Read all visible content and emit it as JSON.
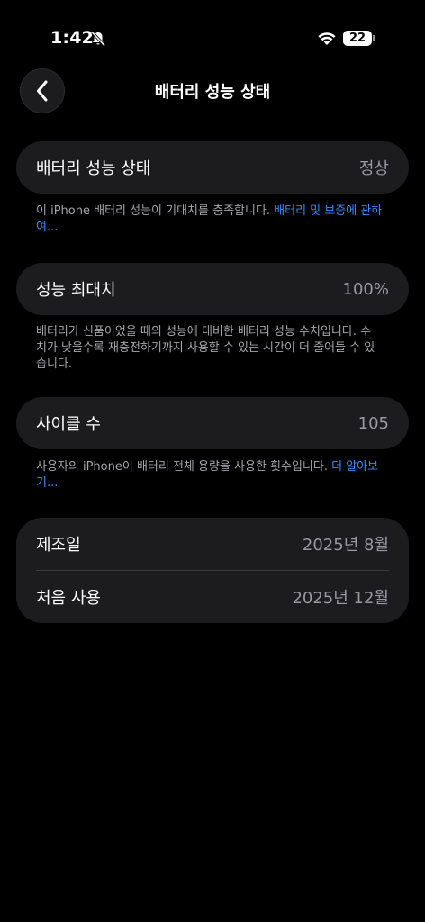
{
  "status_bar": {
    "time": "1:42",
    "battery_level": "22",
    "battery_fraction": 0.22
  },
  "nav": {
    "title": "배터리 성능 상태"
  },
  "sections": {
    "health": {
      "label": "배터리 성능 상태",
      "value": "정상",
      "footnote_text": "이 iPhone 배터리 성능이 기대치를 충족합니다. ",
      "footnote_link": "배터리 및 보증에 관하여..."
    },
    "max_capacity": {
      "label": "성능 최대치",
      "value": "100%",
      "footnote_text": "배터리가 신품이었을 때의 성능에 대비한 배터리 성능 수치입니다. 수치가 낮을수록 재충전하기까지 사용할 수 있는 시간이 더 줄어들 수 있습니다."
    },
    "cycle_count": {
      "label": "사이클 수",
      "value": "105",
      "footnote_text": "사용자의 iPhone이 배터리 전체 용량을 사용한 횟수입니다. ",
      "footnote_link": "더 알아보기..."
    },
    "dates": {
      "manufacture_label": "제조일",
      "manufacture_value": "2025년 8월",
      "first_use_label": "처음 사용",
      "first_use_value": "2025년 12월"
    }
  },
  "colors": {
    "background": "#000000",
    "card": "#1c1c1e",
    "secondary_text": "#98989f",
    "link": "#3a8cff"
  },
  "icons": {
    "mute": "bell-slash-icon",
    "wifi": "wifi-icon",
    "battery": "battery-icon",
    "back": "chevron-left-icon"
  }
}
